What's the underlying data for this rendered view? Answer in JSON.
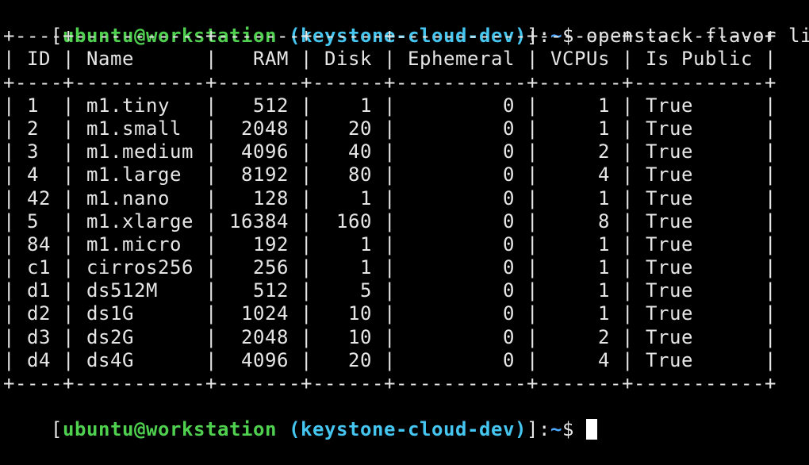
{
  "colors": {
    "background": "#000000",
    "text": "#e6e6e6",
    "user_host": "#4fd04f",
    "env": "#45c6f0",
    "path": "#4da8ff"
  },
  "prompt": {
    "open_bracket": "[",
    "user_host": "ubuntu@workstation",
    "env": "(keystone-cloud-dev)",
    "close": "]:",
    "path": "~",
    "symbol": "$"
  },
  "command": "openstack flavor list",
  "table": {
    "columns": [
      "ID",
      "Name",
      "RAM",
      "Disk",
      "Ephemeral",
      "VCPUs",
      "Is Public"
    ],
    "widths": [
      4,
      11,
      7,
      6,
      11,
      7,
      11
    ],
    "align": [
      "left",
      "left",
      "right",
      "right",
      "right",
      "right",
      "left"
    ],
    "rows": [
      [
        "1",
        "m1.tiny",
        "512",
        "1",
        "0",
        "1",
        "True"
      ],
      [
        "2",
        "m1.small",
        "2048",
        "20",
        "0",
        "1",
        "True"
      ],
      [
        "3",
        "m1.medium",
        "4096",
        "40",
        "0",
        "2",
        "True"
      ],
      [
        "4",
        "m1.large",
        "8192",
        "80",
        "0",
        "4",
        "True"
      ],
      [
        "42",
        "m1.nano",
        "128",
        "1",
        "0",
        "1",
        "True"
      ],
      [
        "5",
        "m1.xlarge",
        "16384",
        "160",
        "0",
        "8",
        "True"
      ],
      [
        "84",
        "m1.micro",
        "192",
        "1",
        "0",
        "1",
        "True"
      ],
      [
        "c1",
        "cirros256",
        "256",
        "1",
        "0",
        "1",
        "True"
      ],
      [
        "d1",
        "ds512M",
        "512",
        "5",
        "0",
        "1",
        "True"
      ],
      [
        "d2",
        "ds1G",
        "1024",
        "10",
        "0",
        "1",
        "True"
      ],
      [
        "d3",
        "ds2G",
        "2048",
        "10",
        "0",
        "2",
        "True"
      ],
      [
        "d4",
        "ds4G",
        "4096",
        "20",
        "0",
        "4",
        "True"
      ]
    ]
  }
}
